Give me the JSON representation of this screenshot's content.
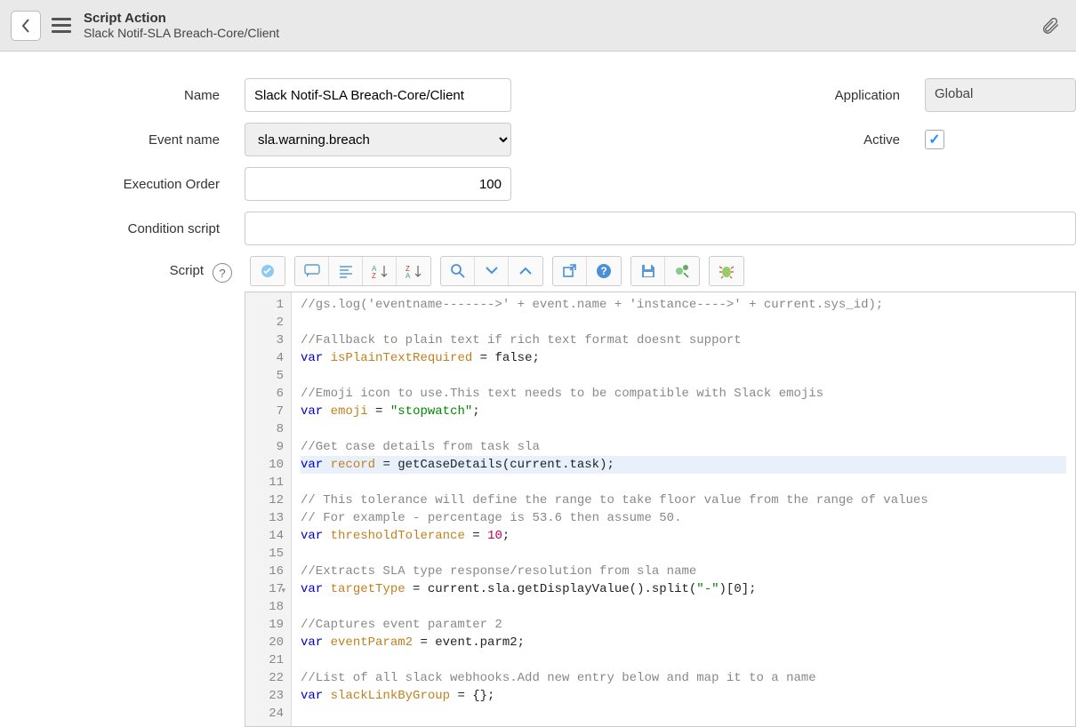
{
  "header": {
    "type": "Script Action",
    "name": "Slack Notif-SLA Breach-Core/Client"
  },
  "form": {
    "name_label": "Name",
    "name_value": "Slack Notif-SLA Breach-Core/Client",
    "application_label": "Application",
    "application_value": "Global",
    "event_label": "Event name",
    "event_value": "sla.warning.breach",
    "active_label": "Active",
    "active_checked": true,
    "order_label": "Execution Order",
    "order_value": "100",
    "condition_label": "Condition script",
    "condition_value": "",
    "script_label": "Script"
  },
  "toolbar_icons": {
    "syntax": "syntax-check-icon",
    "comment": "comment-icon",
    "format": "format-icon",
    "sort_az": "sort-az-icon",
    "sort_za": "sort-za-icon",
    "search": "search-icon",
    "down": "chevron-down-icon",
    "up": "chevron-up-icon",
    "popout": "popout-icon",
    "help": "help-icon",
    "save": "save-icon",
    "script_debug": "debug-icon",
    "script_trace": "trace-icon"
  },
  "code": {
    "lines": [
      {
        "n": 1,
        "raw": "//gs.log('eventname------->' + event.name + 'instance---->' + current.sys_id);",
        "cls": "cm"
      },
      {
        "n": 2,
        "raw": "",
        "cls": ""
      },
      {
        "n": 3,
        "raw": "//Fallback to plain text if rich text format doesnt support",
        "cls": "cm"
      },
      {
        "n": 4,
        "kw": "var",
        "vr": "isPlainTextRequired",
        "rest": " = false;"
      },
      {
        "n": 5,
        "raw": "",
        "cls": ""
      },
      {
        "n": 6,
        "raw": "//Emoji icon to use.This text needs to be compatible with Slack emojis",
        "cls": "cm"
      },
      {
        "n": 7,
        "kw": "var",
        "vr": "emoji",
        "rest": " = ",
        "str": "\"stopwatch\"",
        "tail": ";"
      },
      {
        "n": 8,
        "raw": "",
        "cls": ""
      },
      {
        "n": 9,
        "raw": "//Get case details from task sla",
        "cls": "cm"
      },
      {
        "n": 10,
        "kw": "var",
        "vr": "record",
        "rest": " = getCaseDetails(current.task);",
        "hl": true
      },
      {
        "n": 11,
        "raw": "",
        "cls": ""
      },
      {
        "n": 12,
        "raw": "// This tolerance will define the range to take floor value from the range of values",
        "cls": "cm"
      },
      {
        "n": 13,
        "raw": "// For example - percentage is 53.6 then assume 50.",
        "cls": "cm"
      },
      {
        "n": 14,
        "kw": "var",
        "vr": "thresholdTolerance",
        "rest": " = ",
        "num": "10",
        "tail": ";"
      },
      {
        "n": 15,
        "raw": "",
        "cls": ""
      },
      {
        "n": 16,
        "raw": "//Extracts SLA type response/resolution from sla name",
        "cls": "cm"
      },
      {
        "n": 17,
        "kw": "var",
        "vr": "targetType",
        "rest": " = current.sla.getDisplayValue().split(",
        "str": "\"-\"",
        "tail": ")[0];",
        "fold": true
      },
      {
        "n": 18,
        "raw": "",
        "cls": ""
      },
      {
        "n": 19,
        "raw": "//Captures event paramter 2",
        "cls": "cm"
      },
      {
        "n": 20,
        "kw": "var",
        "vr": "eventParam2",
        "rest": " = event.parm2;"
      },
      {
        "n": 21,
        "raw": "",
        "cls": ""
      },
      {
        "n": 22,
        "raw": "//List of all slack webhooks.Add new entry below and map it to a name",
        "cls": "cm"
      },
      {
        "n": 23,
        "kw": "var",
        "vr": "slackLinkByGroup",
        "rest": " = {};"
      },
      {
        "n": 24,
        "raw": "",
        "cls": ""
      }
    ]
  }
}
